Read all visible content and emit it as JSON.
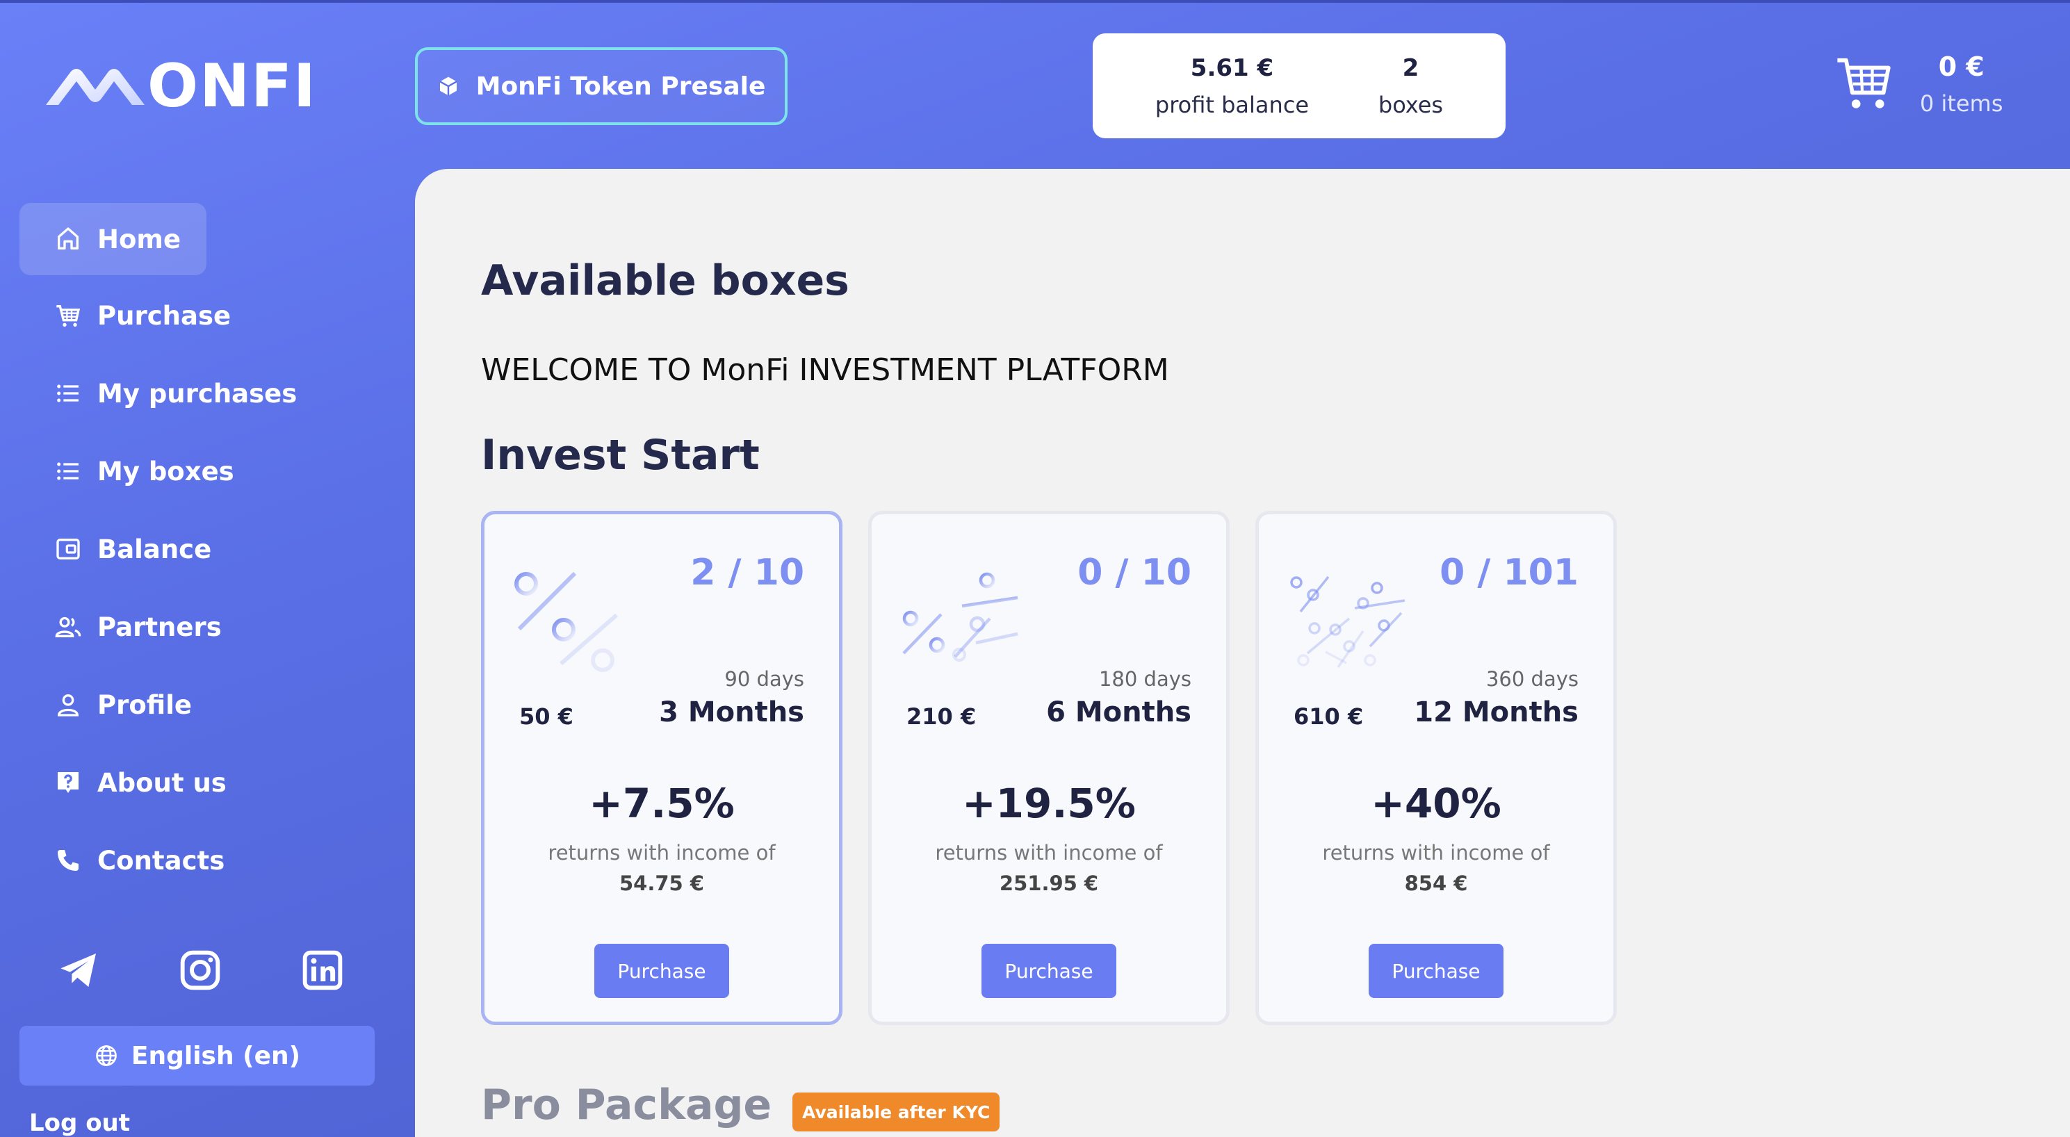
{
  "header": {
    "logo_text": "ONFI",
    "presale_label": "MonFi Token Presale",
    "profit_balance_value": "5.61 €",
    "profit_balance_label": "profit balance",
    "boxes_value": "2",
    "boxes_label": "boxes",
    "cart_amount": "0 €",
    "cart_items": "0 items"
  },
  "sidebar": {
    "items": [
      {
        "label": "Home",
        "icon": "home-icon",
        "active": true
      },
      {
        "label": "Purchase",
        "icon": "cart-icon"
      },
      {
        "label": "My purchases",
        "icon": "list-icon"
      },
      {
        "label": "My boxes",
        "icon": "list-icon"
      },
      {
        "label": "Balance",
        "icon": "wallet-icon"
      },
      {
        "label": "Partners",
        "icon": "users-icon"
      },
      {
        "label": "Profile",
        "icon": "user-icon"
      },
      {
        "label": "About us",
        "icon": "question-icon"
      },
      {
        "label": "Contacts",
        "icon": "phone-icon"
      }
    ],
    "socials": [
      "telegram-icon",
      "instagram-icon",
      "linkedin-icon"
    ],
    "language_label": "English (en)",
    "logout_label": "Log out"
  },
  "main": {
    "available_title": "Available boxes",
    "welcome_text": "WELCOME TO MonFi INVESTMENT PLATFORM",
    "invest_title": "Invest Start",
    "boxes": [
      {
        "count": "2 / 10",
        "days": "90 days",
        "price": "50 €",
        "months": "3 Months",
        "percent": "+7.5%",
        "returns_label": "returns with income of",
        "income": "54.75 €",
        "button": "Purchase"
      },
      {
        "count": "0 / 10",
        "days": "180 days",
        "price": "210 €",
        "months": "6 Months",
        "percent": "+19.5%",
        "returns_label": "returns with income of",
        "income": "251.95 €",
        "button": "Purchase"
      },
      {
        "count": "0 / 101",
        "days": "360 days",
        "price": "610 €",
        "months": "12 Months",
        "percent": "+40%",
        "returns_label": "returns with income of",
        "income": "854 €",
        "button": "Purchase"
      }
    ],
    "pro_title": "Pro Package",
    "kyc_badge": "Available after KYC"
  },
  "colors": {
    "accent": "#6a7cf2",
    "sidebar_gradient_top": "#6a80f7",
    "sidebar_gradient_bottom": "#4a5bc8",
    "presale_border": "#7ee3e8",
    "kyc_badge": "#f0892a"
  }
}
